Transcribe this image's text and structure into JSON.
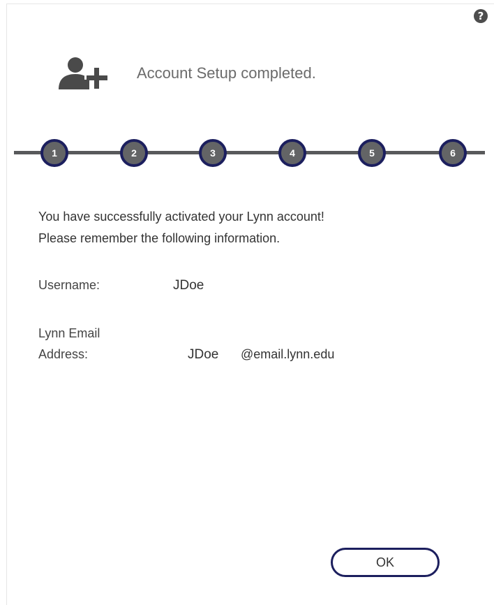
{
  "header": {
    "icon": "user-add-icon",
    "title": "Account Setup completed."
  },
  "help": {
    "icon": "question-circle-icon",
    "label": "?"
  },
  "stepper": {
    "steps": [
      "1",
      "2",
      "3",
      "4",
      "5",
      "6"
    ],
    "colors": {
      "line": "#58595b",
      "fill": "#636466",
      "border": "#1c1f5e"
    }
  },
  "message": {
    "line1": "You have successfully activated your Lynn account!",
    "line2": "Please remember the following information."
  },
  "info": {
    "username_label": "Username:",
    "username_value": "JDoe",
    "email_label_line1": "Lynn Email",
    "email_label_line2": "Address:",
    "email_user": "JDoe",
    "email_domain": "@email.lynn.edu"
  },
  "actions": {
    "ok_label": "OK"
  }
}
